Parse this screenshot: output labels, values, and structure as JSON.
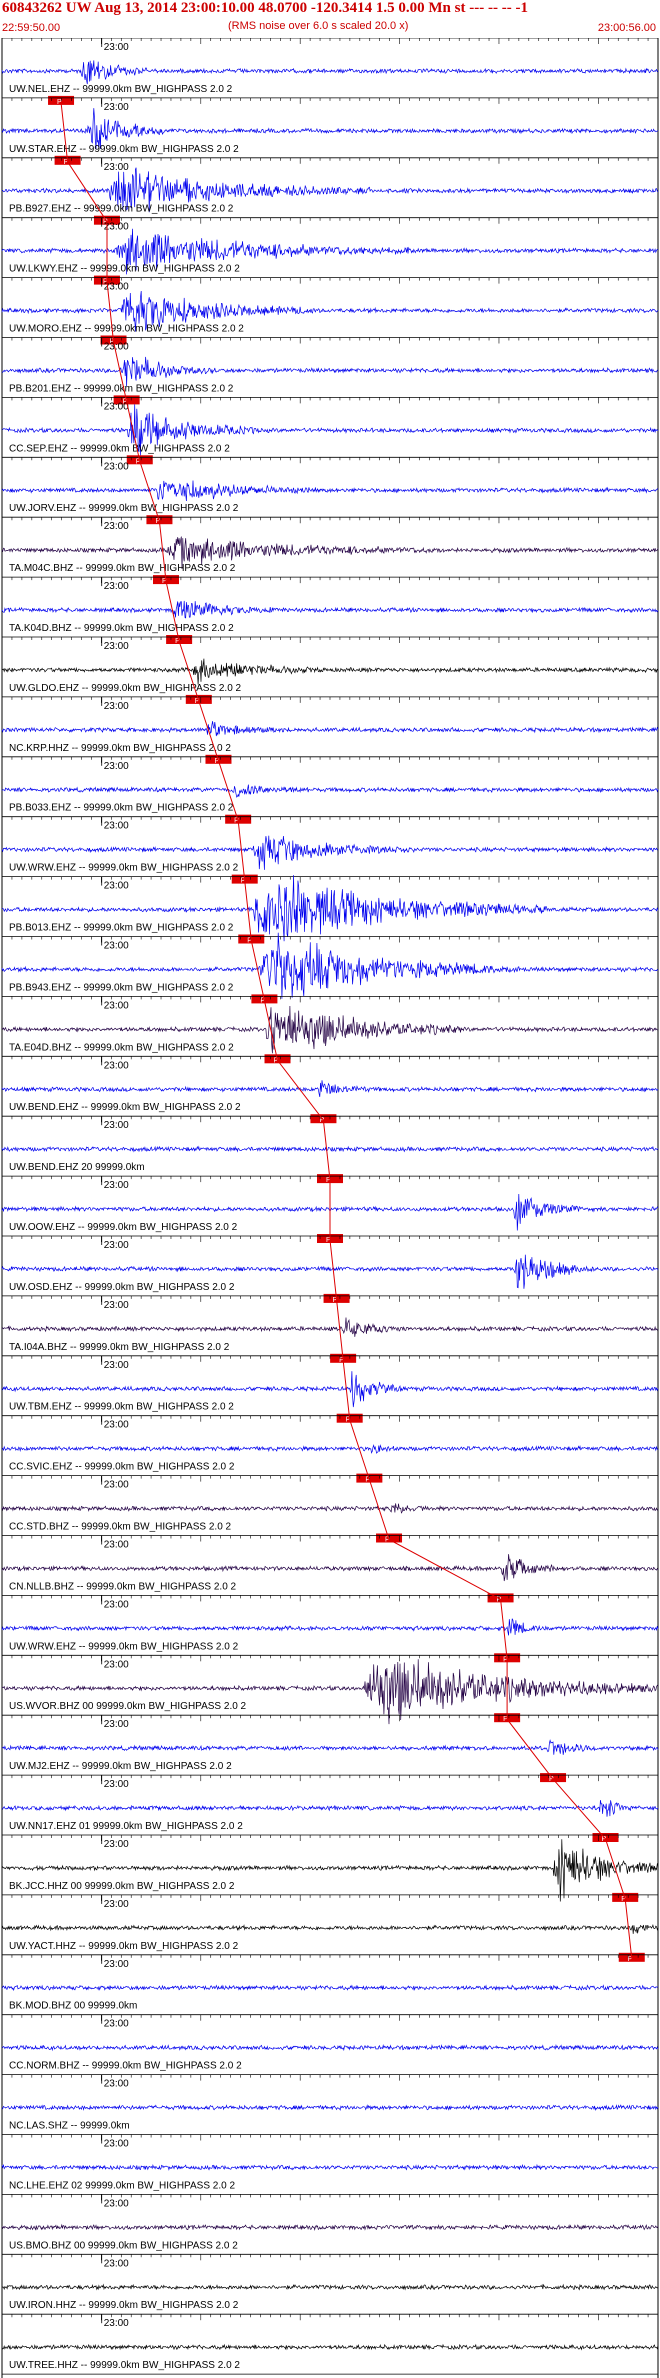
{
  "header": {
    "title": "60843262 UW Aug 13, 2014 23:00:10.00   48.0700 -120.3414  1.5 0.00 Mn st --- -- --  -1",
    "subtitle": "(RMS noise over 6.0 s scaled 20.0 x)",
    "start_time": "22:59:50.00",
    "end_time": "23:00:56.00"
  },
  "colors": {
    "blue": "#0000ee",
    "dark": "#220044",
    "black": "#000000",
    "pick": "#dd0000",
    "text": "#000000"
  },
  "chart_data": {
    "type": "line",
    "title": "60843262 UW Aug 13, 2014 23:00:10.00   48.0700 -120.3414  1.5 0.00 Mn st --- -- --  -1",
    "xlim": [
      "22:59:50.00",
      "23:00:56.00"
    ],
    "minute_label": "23:00",
    "grid": true,
    "pick_label": "P",
    "series": [
      {
        "name": "UW.NEL.EHZ -- 99999.0km BW_HIGHPASS  2.0  2",
        "color": "blue",
        "amp": 0.8,
        "burst_start": 0.12,
        "burst_len": 0.1,
        "pick_time": 0.09,
        "labeled": true
      },
      {
        "name": "UW.STAR.EHZ -- 99999.0km BW_HIGHPASS  2.0  2",
        "color": "blue",
        "amp": 0.9,
        "burst_start": 0.13,
        "burst_len": 0.12,
        "pick_time": 0.1,
        "labeled": true
      },
      {
        "name": "PB.B927.EHZ -- 99999.0km BW_HIGHPASS  2.0  2",
        "color": "blue",
        "amp": 1.0,
        "burst_start": 0.16,
        "burst_len": 0.4,
        "pick_time": 0.16,
        "labeled": true
      },
      {
        "name": "UW.LKWY.EHZ -- 99999.0km BW_HIGHPASS  2.0  2",
        "color": "blue",
        "amp": 0.9,
        "burst_start": 0.17,
        "burst_len": 0.45,
        "pick_time": 0.16,
        "labeled": true
      },
      {
        "name": "UW.MORO.EHZ -- 99999.0km BW_HIGHPASS  2.0  2",
        "color": "blue",
        "amp": 0.9,
        "burst_start": 0.18,
        "burst_len": 0.3,
        "pick_time": 0.17,
        "labeled": true
      },
      {
        "name": "PB.B201.EHZ -- 99999.0km BW_HIGHPASS  2.0  2",
        "color": "blue",
        "amp": 0.7,
        "burst_start": 0.18,
        "burst_len": 0.15,
        "pick_time": 0.19,
        "labeled": true
      },
      {
        "name": "CC.SEP.EHZ -- 99999.0km BW_HIGHPASS  2.0  2",
        "color": "blue",
        "amp": 1.0,
        "burst_start": 0.19,
        "burst_len": 0.2,
        "pick_time": 0.21,
        "labeled": true
      },
      {
        "name": "UW.JORV.EHZ -- 99999.0km BW_HIGHPASS  2.0  2",
        "color": "blue",
        "amp": 0.6,
        "burst_start": 0.23,
        "burst_len": 0.25,
        "pick_time": 0.24,
        "labeled": true
      },
      {
        "name": "TA.M04C.BHZ -- 99999.0km BW_HIGHPASS  2.0  2",
        "color": "dark",
        "amp": 0.6,
        "burst_start": 0.25,
        "burst_len": 0.4,
        "pick_time": 0.25,
        "labeled": true
      },
      {
        "name": "TA.K04D.BHZ -- 99999.0km BW_HIGHPASS  2.0  2",
        "color": "blue",
        "amp": 0.5,
        "burst_start": 0.26,
        "burst_len": 0.15,
        "pick_time": 0.27,
        "labeled": true
      },
      {
        "name": "UW.GLDO.EHZ -- 99999.0km BW_HIGHPASS  2.0  2",
        "color": "black",
        "amp": 0.5,
        "burst_start": 0.29,
        "burst_len": 0.2,
        "pick_time": 0.3,
        "labeled": true
      },
      {
        "name": "NC.KRP.HHZ -- 99999.0km BW_HIGHPASS  2.0  2",
        "color": "blue",
        "amp": 0.3,
        "burst_start": 0.31,
        "burst_len": 0.12,
        "pick_time": 0.33,
        "labeled": true
      },
      {
        "name": "PB.B033.EHZ -- 99999.0km BW_HIGHPASS  2.0  2",
        "color": "blue",
        "amp": 0.3,
        "burst_start": 0.35,
        "burst_len": 0.12,
        "pick_time": 0.36,
        "labeled": true
      },
      {
        "name": "UW.WRW.EHZ -- 99999.0km BW_HIGHPASS  2.0  2",
        "color": "blue",
        "amp": 0.7,
        "burst_start": 0.38,
        "burst_len": 0.25,
        "pick_time": 0.37,
        "labeled": true
      },
      {
        "name": "PB.B013.EHZ -- 99999.0km BW_HIGHPASS  2.0  2",
        "color": "blue",
        "amp": 1.5,
        "burst_start": 0.38,
        "burst_len": 0.45,
        "pick_time": 0.38,
        "labeled": true
      },
      {
        "name": "PB.B943.EHZ -- 99999.0km BW_HIGHPASS  2.0  2",
        "color": "blue",
        "amp": 1.4,
        "burst_start": 0.39,
        "burst_len": 0.4,
        "pick_time": 0.4,
        "labeled": true
      },
      {
        "name": "TA.E04D.BHZ -- 99999.0km BW_HIGHPASS  2.0  2",
        "color": "dark",
        "amp": 1.3,
        "burst_start": 0.4,
        "burst_len": 0.3,
        "pick_time": 0.42,
        "labeled": true
      },
      {
        "name": "UW.BEND.EHZ -- 99999.0km BW_HIGHPASS  2.0  2",
        "color": "blue",
        "amp": 0.4,
        "burst_start": 0.48,
        "burst_len": 0.08,
        "pick_time": 0.49,
        "labeled": true
      },
      {
        "name": "UW.BEND.EHZ 20 99999.0km",
        "color": "blue",
        "amp": 0.0,
        "burst_start": 1.0,
        "burst_len": 0.0,
        "pick_time": 0.5,
        "labeled": false
      },
      {
        "name": "UW.OOW.EHZ -- 99999.0km BW_HIGHPASS  2.0  2",
        "color": "blue",
        "amp": 0.9,
        "burst_start": 0.78,
        "burst_len": 0.1,
        "pick_time": 0.5,
        "labeled": false
      },
      {
        "name": "UW.OSD.EHZ -- 99999.0km BW_HIGHPASS  2.0  2",
        "color": "blue",
        "amp": 1.0,
        "burst_start": 0.78,
        "burst_len": 0.12,
        "pick_time": 0.51,
        "labeled": true
      },
      {
        "name": "TA.I04A.BHZ -- 99999.0km BW_HIGHPASS  2.0  2",
        "color": "dark",
        "amp": 0.4,
        "burst_start": 0.52,
        "burst_len": 0.1,
        "pick_time": 0.52,
        "labeled": true
      },
      {
        "name": "UW.TBM.EHZ -- 99999.0km BW_HIGHPASS  2.0  2",
        "color": "blue",
        "amp": 0.8,
        "burst_start": 0.53,
        "burst_len": 0.08,
        "pick_time": 0.53,
        "labeled": true
      },
      {
        "name": "CC.SVIC.EHZ -- 99999.0km BW_HIGHPASS  2.0  2",
        "color": "blue",
        "amp": 0.2,
        "burst_start": 0.56,
        "burst_len": 0.05,
        "pick_time": 0.56,
        "labeled": true
      },
      {
        "name": "CC.STD.BHZ -- 99999.0km BW_HIGHPASS  2.0  2",
        "color": "dark",
        "amp": 0.3,
        "burst_start": 0.59,
        "burst_len": 0.05,
        "pick_time": 0.59,
        "labeled": true
      },
      {
        "name": "CN.NLLB.BHZ -- 99999.0km BW_HIGHPASS  2.0  2",
        "color": "dark",
        "amp": 0.6,
        "burst_start": 0.76,
        "burst_len": 0.1,
        "pick_time": 0.76,
        "labeled": true
      },
      {
        "name": "UW.WRW.EHZ -- 99999.0km BW_HIGHPASS  2.0  2",
        "color": "blue",
        "amp": 0.5,
        "burst_start": 0.77,
        "burst_len": 0.05,
        "pick_time": 0.77,
        "labeled": true
      },
      {
        "name": "US.WVOR.BHZ 00 99999.0km BW_HIGHPASS  2.0  2",
        "color": "dark",
        "amp": 1.5,
        "burst_start": 0.55,
        "burst_len": 0.45,
        "pick_time": 0.77,
        "labeled": true
      },
      {
        "name": "UW.MJ2.EHZ -- 99999.0km BW_HIGHPASS  2.0  2",
        "color": "blue",
        "amp": 0.5,
        "burst_start": 0.83,
        "burst_len": 0.08,
        "pick_time": 0.84,
        "labeled": true
      },
      {
        "name": "UW.NN17.EHZ 01 99999.0km BW_HIGHPASS  2.0  2",
        "color": "blue",
        "amp": 0.6,
        "burst_start": 0.91,
        "burst_len": 0.05,
        "pick_time": 0.92,
        "labeled": true
      },
      {
        "name": "BK.JCC.HHZ 00 99999.0km BW_HIGHPASS  2.0  2",
        "color": "black",
        "amp": 1.4,
        "burst_start": 0.84,
        "burst_len": 0.16,
        "pick_time": 0.95,
        "labeled": true
      },
      {
        "name": "UW.YACT.HHZ -- 99999.0km BW_HIGHPASS  2.0  2",
        "color": "black",
        "amp": 0.3,
        "burst_start": 0.96,
        "burst_len": 0.04,
        "pick_time": 0.96,
        "labeled": true
      },
      {
        "name": "BK.MOD.BHZ 00 99999.0km",
        "color": "blue",
        "amp": 0.0,
        "burst_start": 1.0,
        "burst_len": 0.0,
        "pick_time": null,
        "labeled": true
      },
      {
        "name": "CC.NORM.BHZ -- 99999.0km BW_HIGHPASS  2.0  2",
        "color": "blue",
        "amp": 0.1,
        "burst_start": 1.0,
        "burst_len": 0.0,
        "pick_time": null,
        "labeled": true
      },
      {
        "name": "NC.LAS.SHZ -- 99999.0km",
        "color": "blue",
        "amp": 0.0,
        "burst_start": 1.0,
        "burst_len": 0.0,
        "pick_time": null,
        "labeled": true
      },
      {
        "name": "NC.LHE.EHZ 02 99999.0km BW_HIGHPASS  2.0  2",
        "color": "blue",
        "amp": 0.15,
        "burst_start": 1.0,
        "burst_len": 0.0,
        "pick_time": null,
        "labeled": true
      },
      {
        "name": "US.BMO.BHZ 00 99999.0km BW_HIGHPASS  2.0  2",
        "color": "dark",
        "amp": 0.15,
        "burst_start": 1.0,
        "burst_len": 0.0,
        "pick_time": null,
        "labeled": true
      },
      {
        "name": "UW.IRON.HHZ -- 99999.0km BW_HIGHPASS  2.0  2",
        "color": "black",
        "amp": 0.2,
        "burst_start": 1.0,
        "burst_len": 0.0,
        "pick_time": null,
        "labeled": true
      },
      {
        "name": "UW.TREE.HHZ -- 99999.0km BW_HIGHPASS  2.0  2",
        "color": "black",
        "amp": 0.2,
        "burst_start": 1.0,
        "burst_len": 0.0,
        "pick_time": null,
        "labeled": true
      }
    ]
  }
}
